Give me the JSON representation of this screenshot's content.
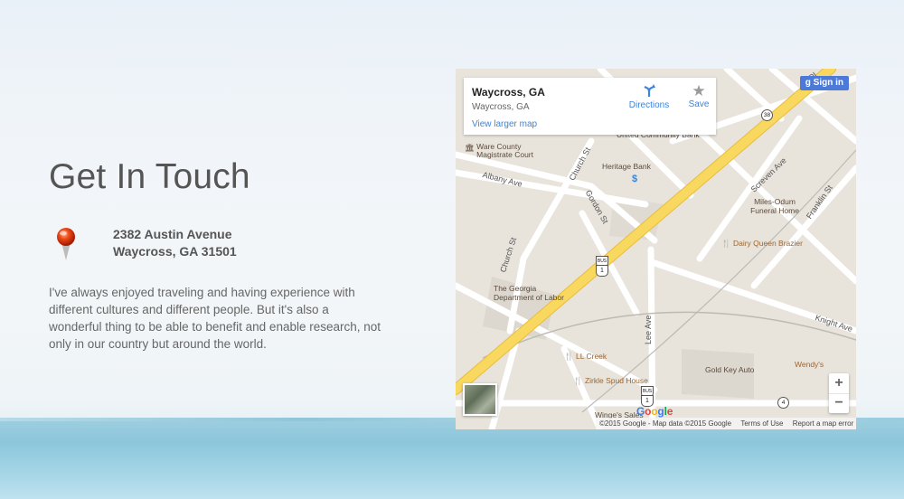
{
  "heading": "Get In Touch",
  "address": {
    "line1": "2382 Austin Avenue",
    "line2": "Waycross, GA 31501"
  },
  "description": "I've always enjoyed traveling and having experience with different cultures and different people. But it's also a wonderful thing to be able to benefit and enable research, not only in our country but around the world.",
  "map": {
    "place_name": "Waycross, GA",
    "place_sub": "Waycross, GA",
    "larger_map_link": "View larger map",
    "directions_label": "Directions",
    "save_label": "Save",
    "signin_label": "Sign in",
    "zoom_in": "+",
    "zoom_out": "−",
    "google_logo": "Google",
    "attribution": [
      "©2015 Google - Map data ©2015 Google",
      "Terms of Use",
      "Report a map error"
    ],
    "streets": [
      "Albany Ave",
      "Church St",
      "Gordon St",
      "Church St",
      "Screven Ave",
      "Franklin St",
      "Knight Ave",
      "Lee Ave",
      "Pl"
    ],
    "places": [
      "Ware County Magistrate Court",
      "Heritage Bank",
      "United Community Bank",
      "Miles-Odum Funeral Home",
      "Dairy Queen Brazier",
      "The Georgia Department of Labor",
      "LL Creek",
      "Zirkle Spud House",
      "Gold Key Auto",
      "Wendy's",
      "Winge's Sales"
    ],
    "shields": [
      "38",
      "BUS",
      "1",
      "BUS",
      "1",
      "4"
    ],
    "colors": {
      "land": "#e8e4dc",
      "road": "#ffffff",
      "highway": "#f9d85f",
      "link": "#3a84df",
      "signin_bg": "#4d7ad9"
    }
  },
  "colors": {
    "text": "#555555",
    "sea": "#8cc6dc"
  }
}
